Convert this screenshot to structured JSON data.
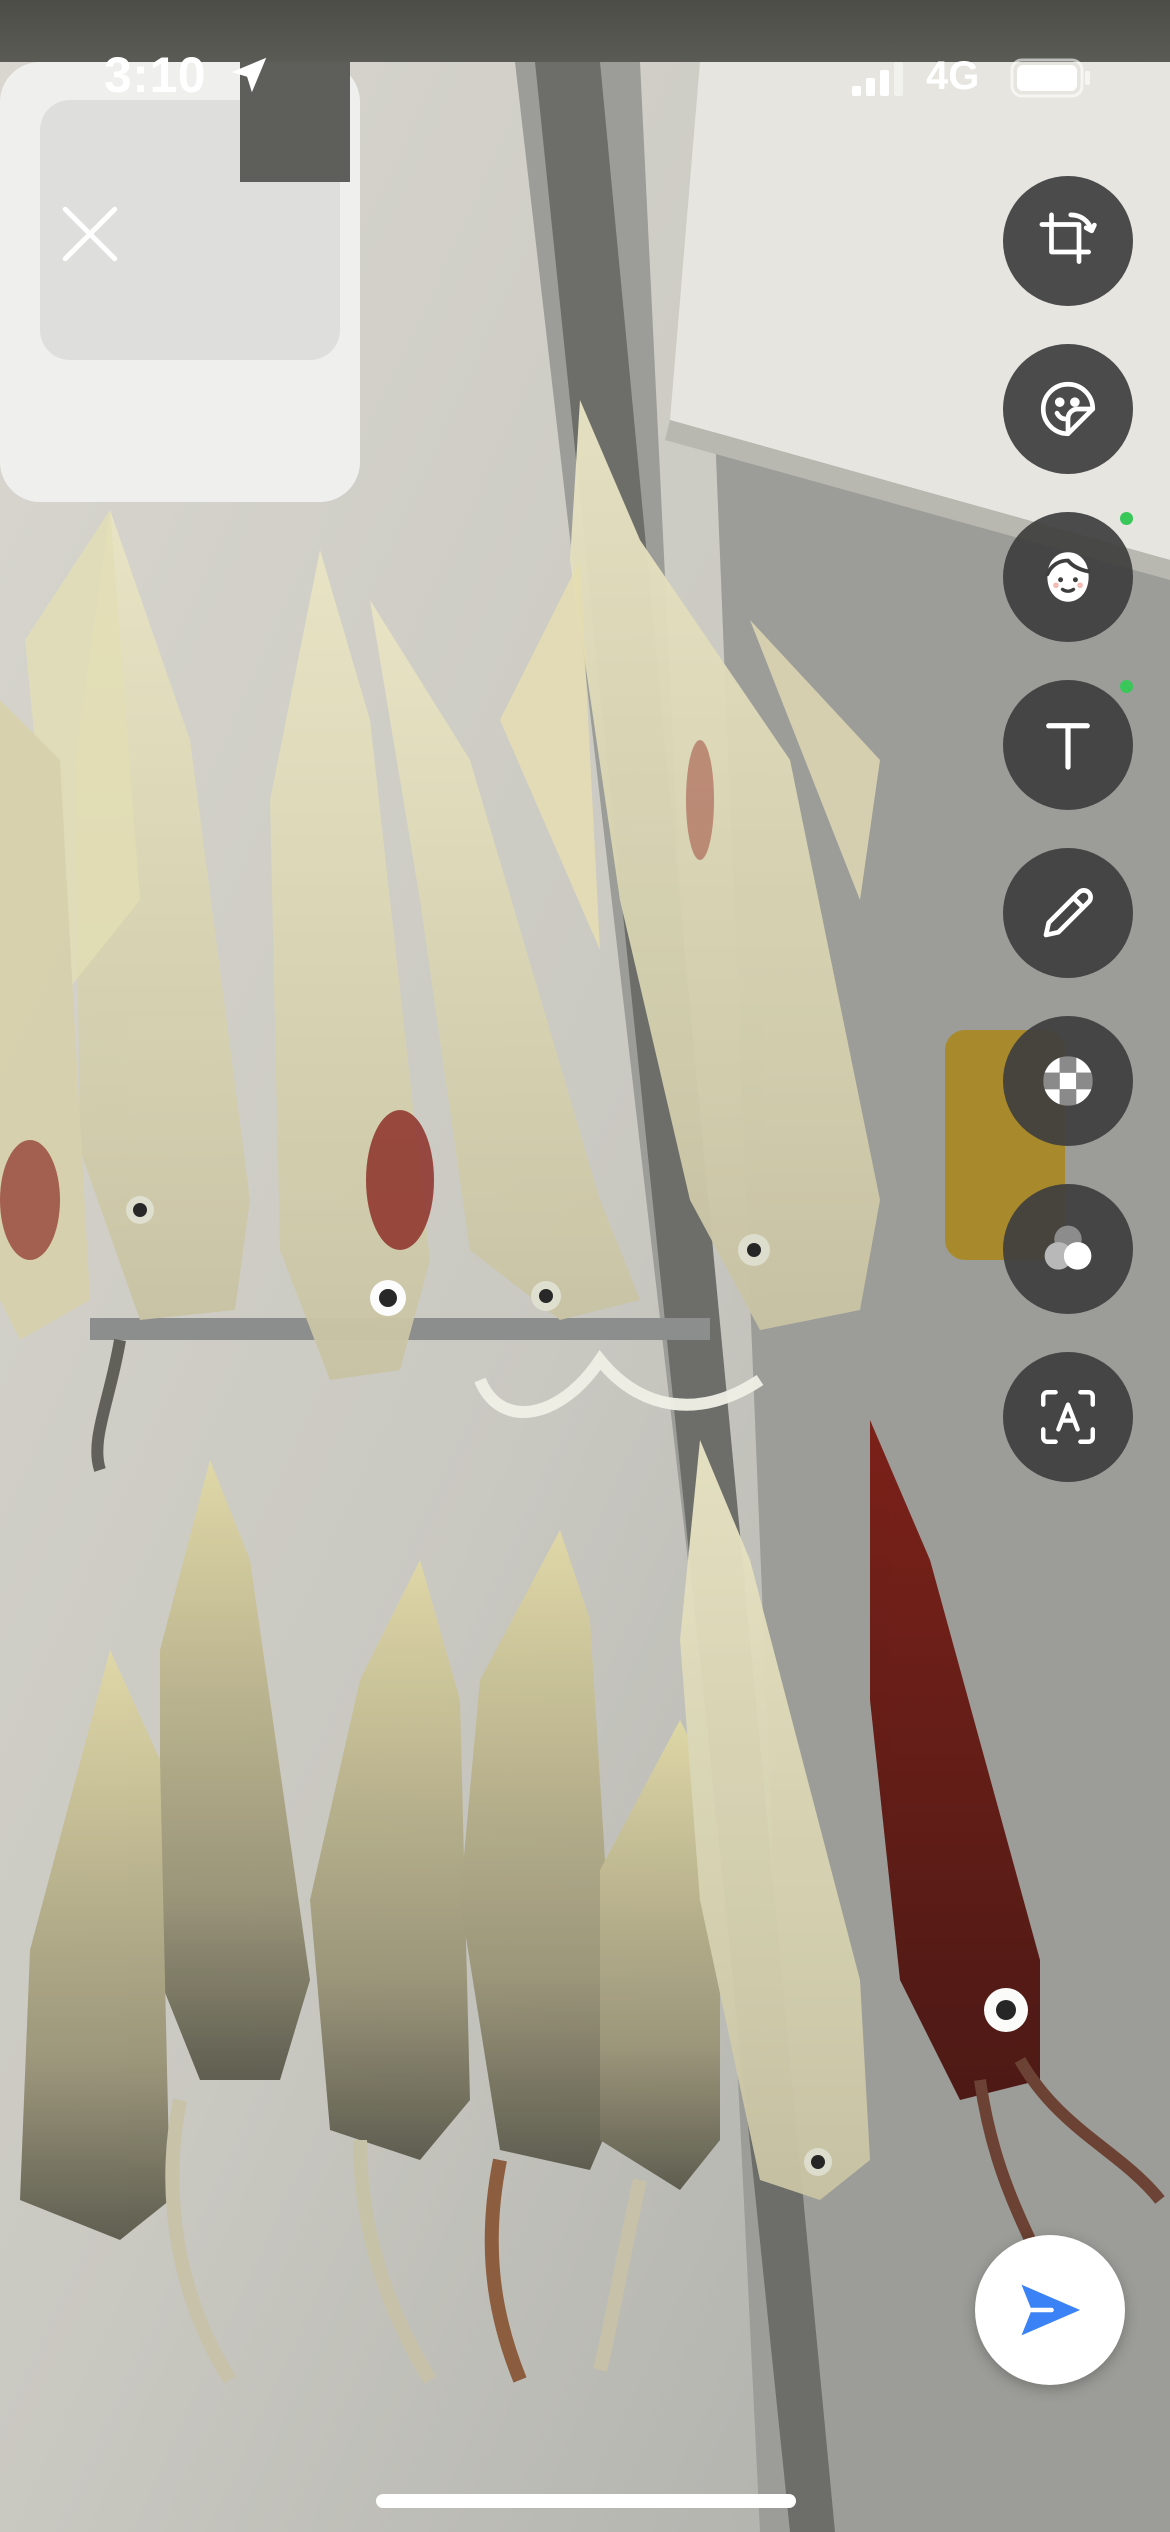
{
  "status_bar": {
    "time": "3:10",
    "network": "4G"
  },
  "toolbar": {
    "items": [
      {
        "name": "crop",
        "icon": "crop-rotate-icon"
      },
      {
        "name": "sticker",
        "icon": "sticker-icon"
      },
      {
        "name": "avatar",
        "icon": "face-avatar-icon",
        "new_dot": true
      },
      {
        "name": "text",
        "icon": "text-icon",
        "new_dot": true
      },
      {
        "name": "draw",
        "icon": "pencil-icon"
      },
      {
        "name": "mosaic",
        "icon": "mosaic-icon"
      },
      {
        "name": "filter",
        "icon": "filter-circles-icon"
      },
      {
        "name": "ocr",
        "icon": "text-recognition-icon"
      }
    ]
  },
  "colors": {
    "toolbar_button_bg": "#3e3e3e",
    "new_dot": "#39c75a",
    "send_icon": "#3b82f6",
    "send_button_bg": "#ffffff"
  }
}
